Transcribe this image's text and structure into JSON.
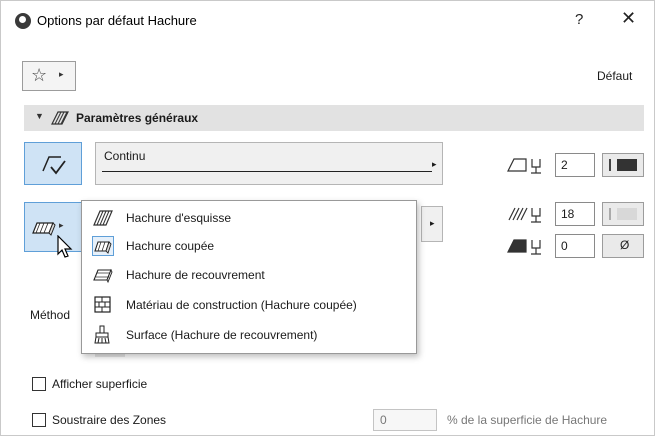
{
  "window": {
    "title": "Options par défaut Hachure",
    "help_label": "?",
    "close_label": "✕"
  },
  "favorites": {
    "star_icon": "star-icon",
    "menu_arrow": "▸"
  },
  "default_label": "Défaut",
  "section": {
    "collapse_arrow": "▼",
    "title": "Paramètres généraux"
  },
  "line_type": {
    "value": "Continu",
    "arrow": "▸"
  },
  "fill_type": {
    "arrow": "▸"
  },
  "pens": [
    {
      "icon": "contour-pen-icon",
      "value": "2",
      "swatch": "dark"
    },
    {
      "icon": "foreground-pen-icon",
      "value": "18",
      "swatch": "light"
    },
    {
      "icon": "background-pen-icon",
      "value": "0",
      "swatch": "empty",
      "swatch_text": "Ø"
    }
  ],
  "method_label": "Méthod",
  "fill_menu": {
    "items": [
      {
        "label": "Hachure d'esquisse",
        "icon": "drafting-fill-icon",
        "selected": false
      },
      {
        "label": "Hachure coupée",
        "icon": "cut-fill-icon",
        "selected": true
      },
      {
        "label": "Hachure de recouvrement",
        "icon": "cover-fill-icon",
        "selected": false
      },
      {
        "label": "Matériau de construction (Hachure coupée)",
        "icon": "building-material-icon",
        "selected": false
      },
      {
        "label": "Surface (Hachure de recouvrement)",
        "icon": "surface-icon",
        "selected": false
      }
    ]
  },
  "checkboxes": {
    "show_area": {
      "label": "Afficher superficie",
      "checked": false
    },
    "subtract_zones": {
      "label": "Soustraire des Zones",
      "checked": false
    }
  },
  "percentage": {
    "value": "0",
    "label": "% de la superficie de Hachure"
  },
  "colors": {
    "accent": "#5f9fd8",
    "accent_bg": "#cfe3f5",
    "section_bg": "#e2e2e2"
  }
}
